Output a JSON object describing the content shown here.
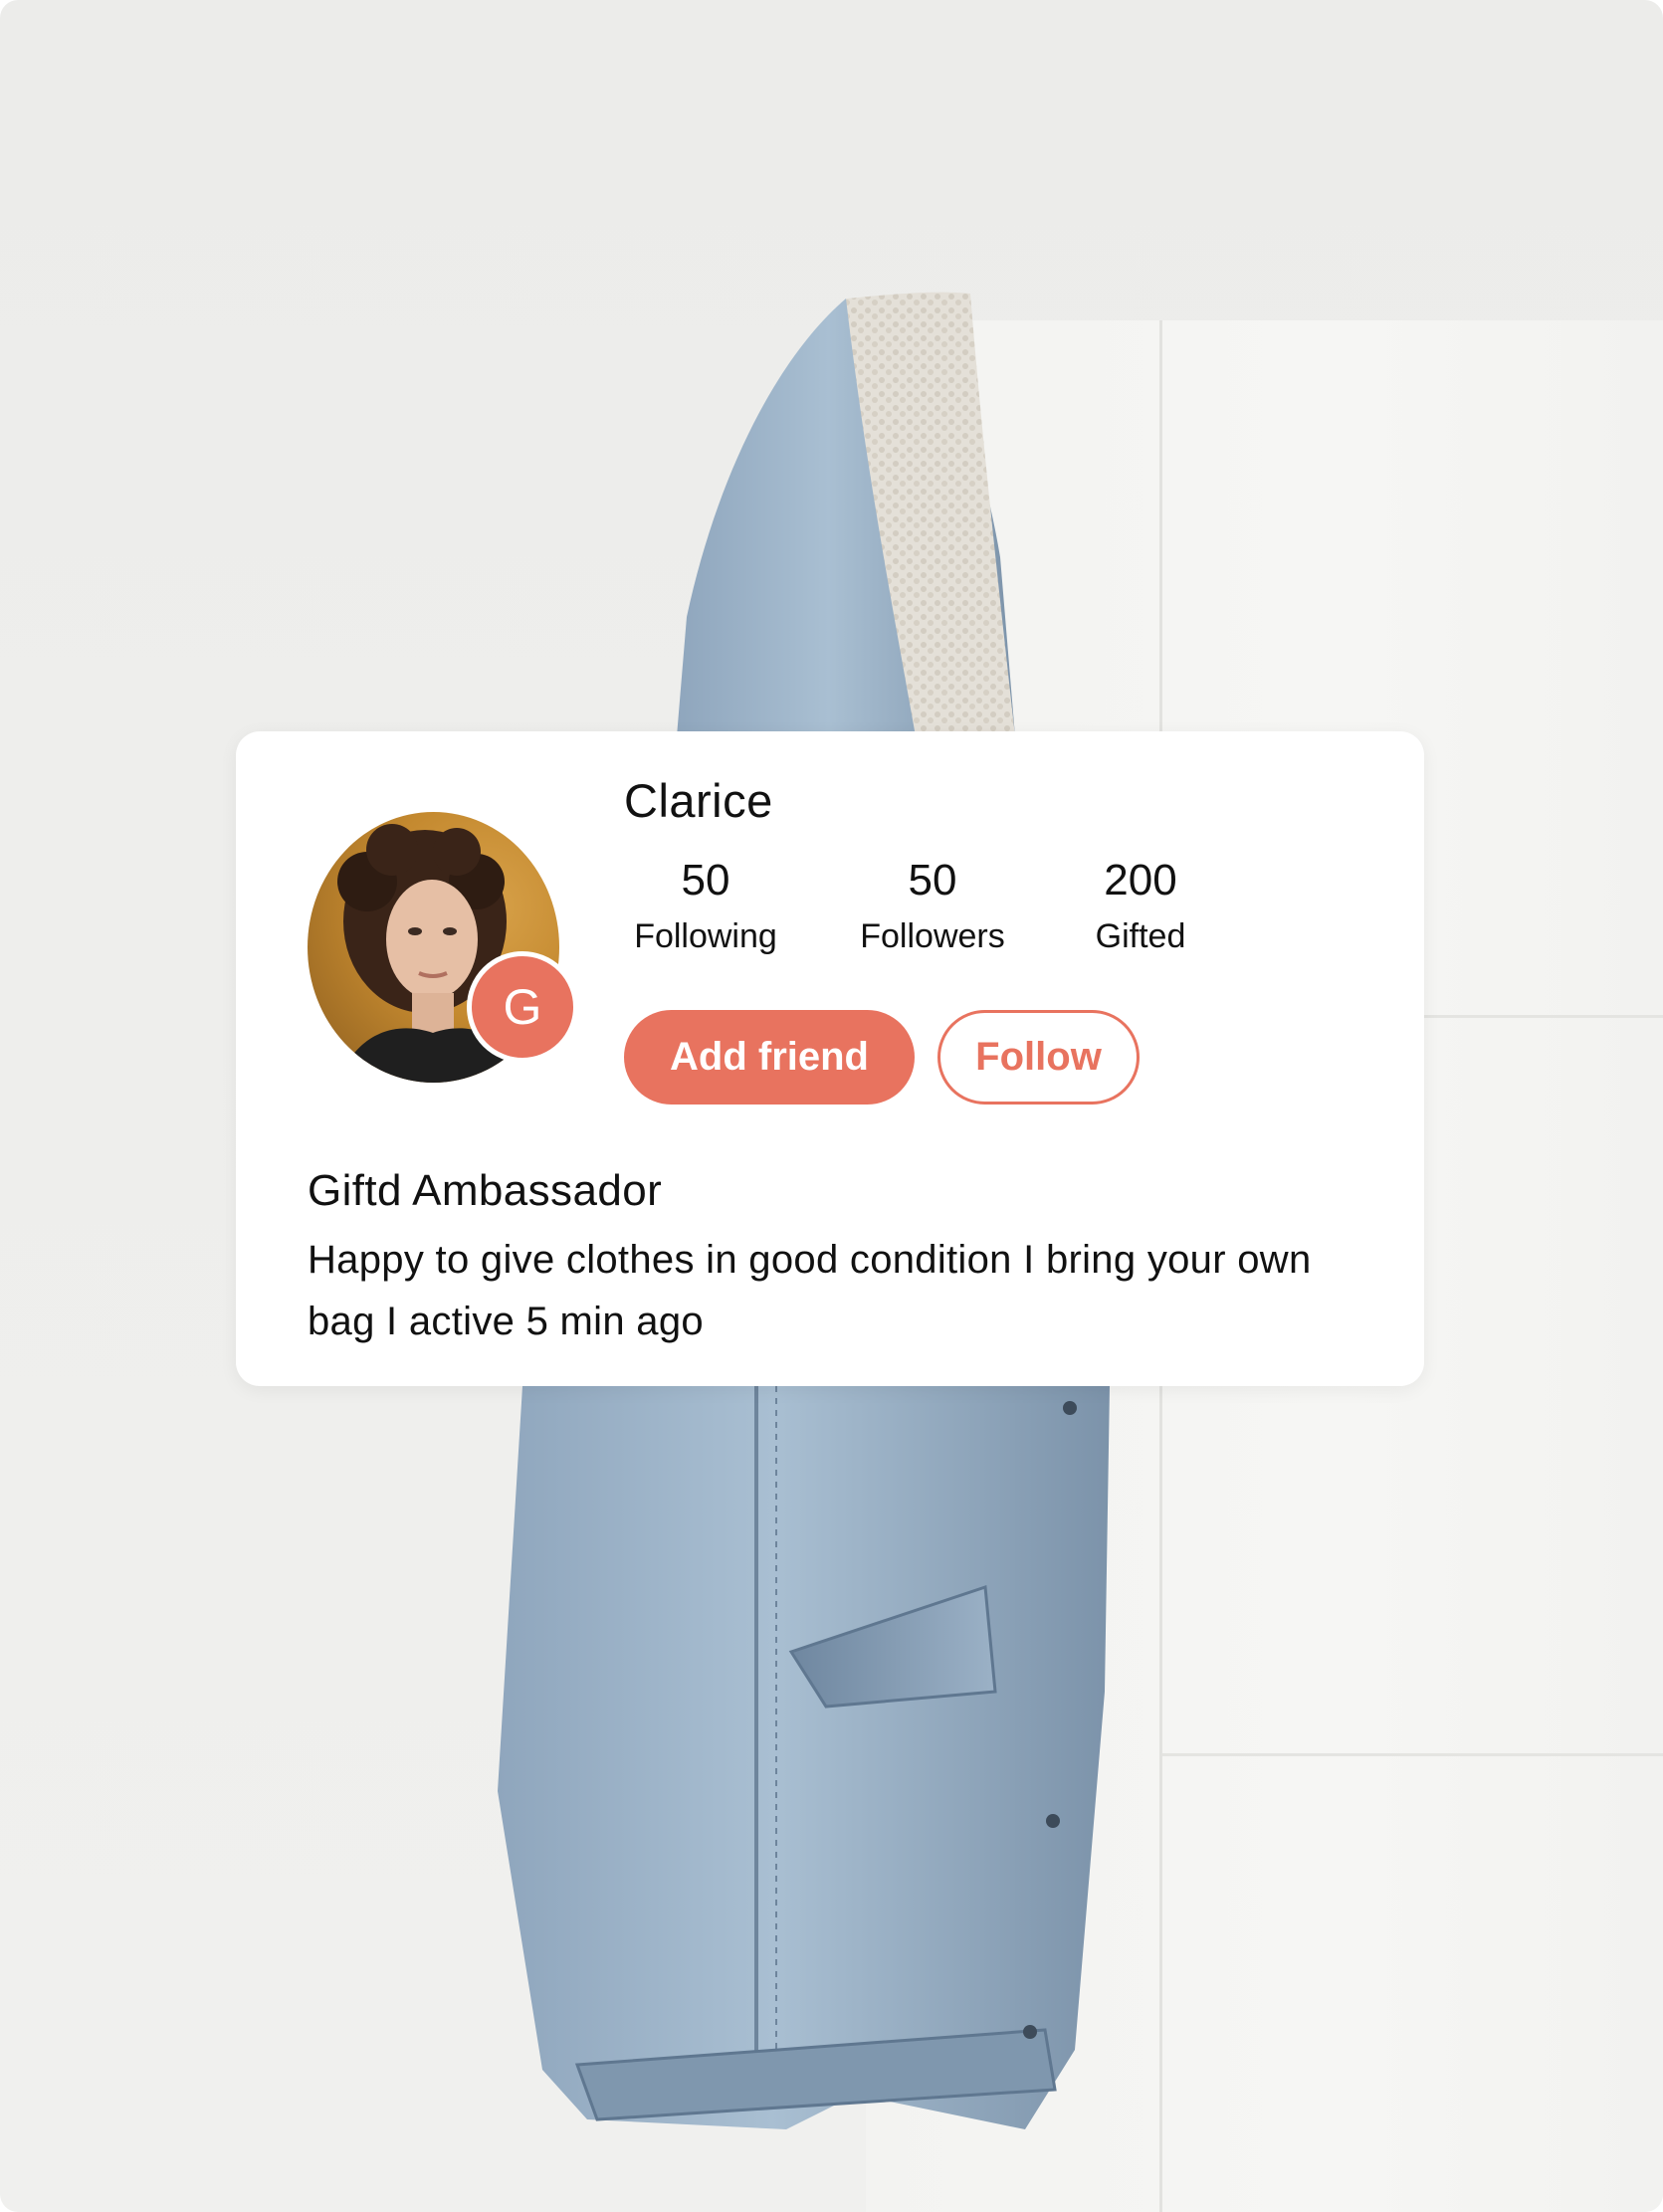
{
  "profile": {
    "name": "Clarice",
    "badge_letter": "G",
    "stats": [
      {
        "value": "50",
        "label": "Following"
      },
      {
        "value": "50",
        "label": "Followers"
      },
      {
        "value": "200",
        "label": "Gifted"
      }
    ],
    "add_friend_label": "Add friend",
    "follow_label": "Follow",
    "title": "Giftd Ambassador",
    "bio": "Happy to give clothes in good condition I bring your own bag I active 5 min ago"
  },
  "colors": {
    "accent": "#e8735f",
    "card_bg": "#ffffff",
    "text": "#111111"
  }
}
